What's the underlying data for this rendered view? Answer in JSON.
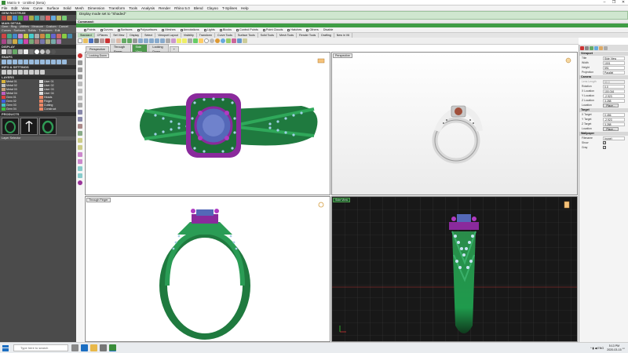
{
  "window": {
    "title": "Matrix 9 · Untitled (Beta)",
    "controls": [
      "–",
      "❐",
      "✕"
    ]
  },
  "menu": [
    "File",
    "Edit",
    "View",
    "Curve",
    "Surface",
    "Solid",
    "Mesh",
    "Dimension",
    "Transform",
    "Tools",
    "Analysis",
    "Render",
    "Rhino 5.0",
    "Blend",
    "Clayoo",
    "T-Splines",
    "Help"
  ],
  "left_panel": {
    "sections": {
      "gem_rostrum": "GEM ROSTRUM",
      "main_menu": "MAIN DETAIL",
      "display": "DISPLAY",
      "snaps": "SNAPS",
      "info_settings": "INFO & SETTINGS",
      "layers": "LAYERS",
      "products": "PRODUCTS"
    },
    "main_tabs": [
      "Gem",
      "Ring",
      "Utilities",
      "Measure",
      "Custom",
      "Cancel"
    ],
    "main_sub": "Curves · Surfaces · Solids · Transform · Edit",
    "layers": [
      {
        "name": "Metal 01",
        "color": "#d8b23a"
      },
      {
        "name": "Metal 02",
        "color": "#c0c0c0"
      },
      {
        "name": "Metal 03",
        "color": "#c7a27a"
      },
      {
        "name": "Metal 04",
        "color": "#c060c0"
      },
      {
        "name": "Gem 01",
        "color": "#e04040"
      },
      {
        "name": "Gem 02",
        "color": "#4060e0"
      },
      {
        "name": "Gem 03",
        "color": "#40c0c0"
      },
      {
        "name": "Gem 04",
        "color": "#40c040"
      }
    ],
    "layers_right": [
      "User 01",
      "User 02",
      "User 03",
      "User 04",
      "Heads",
      "Finger",
      "Cutting",
      "Construct"
    ],
    "product_labels": [
      "Layer Selector"
    ]
  },
  "status": {
    "line1": "Display mode set to \"Shaded\"",
    "line2": "Command:"
  },
  "filters": [
    "Points",
    "Curves",
    "Surfaces",
    "Polysurfaces",
    "Meshes",
    "Annotations",
    "Lights",
    "Blocks",
    "Control Points",
    "Point Clouds",
    "Hatches",
    "Others",
    "Disable"
  ],
  "tabs1": [
    "Standard",
    "CPlanes",
    "Set View",
    "Display",
    "Select",
    "Viewport Layout",
    "Visibility",
    "Transform",
    "Curve Tools",
    "Surface Tools",
    "Solid Tools",
    "Mesh Tools",
    "Render Tools",
    "Drafting",
    "New in V6"
  ],
  "view_tabs": [
    "Perspective",
    "Through Finger",
    "Side View",
    "Looking Down",
    "+"
  ],
  "viewports": {
    "top_left": "Looking Down",
    "top_right": "Perspective",
    "bottom_left": "Through Finger",
    "bottom_right": "Side View"
  },
  "properties": {
    "viewport_section": "Viewport",
    "rows": [
      {
        "k": "Title",
        "v": "Side View"
      },
      {
        "k": "Width",
        "v": "1001"
      },
      {
        "k": "Height",
        "v": "591"
      },
      {
        "k": "Projection",
        "v": "Parallel"
      }
    ],
    "camera_section": "Camera",
    "camera_rows": [
      {
        "k": "Lens Length",
        "v": "50.0"
      },
      {
        "k": "Rotation",
        "v": "0.0"
      },
      {
        "k": "X Location",
        "v": "100.016"
      },
      {
        "k": "Y Location",
        "v": "-2.923"
      },
      {
        "k": "Z Location",
        "v": "3.288"
      }
    ],
    "location_label": "Location",
    "place_label": "Place...",
    "target_section": "Target",
    "target_rows": [
      {
        "k": "X Target",
        "v": "0.456"
      },
      {
        "k": "Y Target",
        "v": "-2.923"
      },
      {
        "k": "Z Target",
        "v": "3.288"
      }
    ],
    "wallpaper_section": "Wallpaper",
    "wallpaper_rows": [
      {
        "k": "Filename",
        "v": "(none)"
      },
      {
        "k": "Show",
        "v": "✓"
      },
      {
        "k": "Gray",
        "v": "✓"
      }
    ]
  },
  "taskbar": {
    "search_placeholder": "Type here to search",
    "time": "5:13 PM",
    "date": "2020-03-15",
    "lang": "ENG"
  },
  "colors": {
    "ring_green": "#2f9a55",
    "purple": "#8a2a9c",
    "gem_blue": "#5468b8",
    "accent_green": "#3f9d45"
  }
}
